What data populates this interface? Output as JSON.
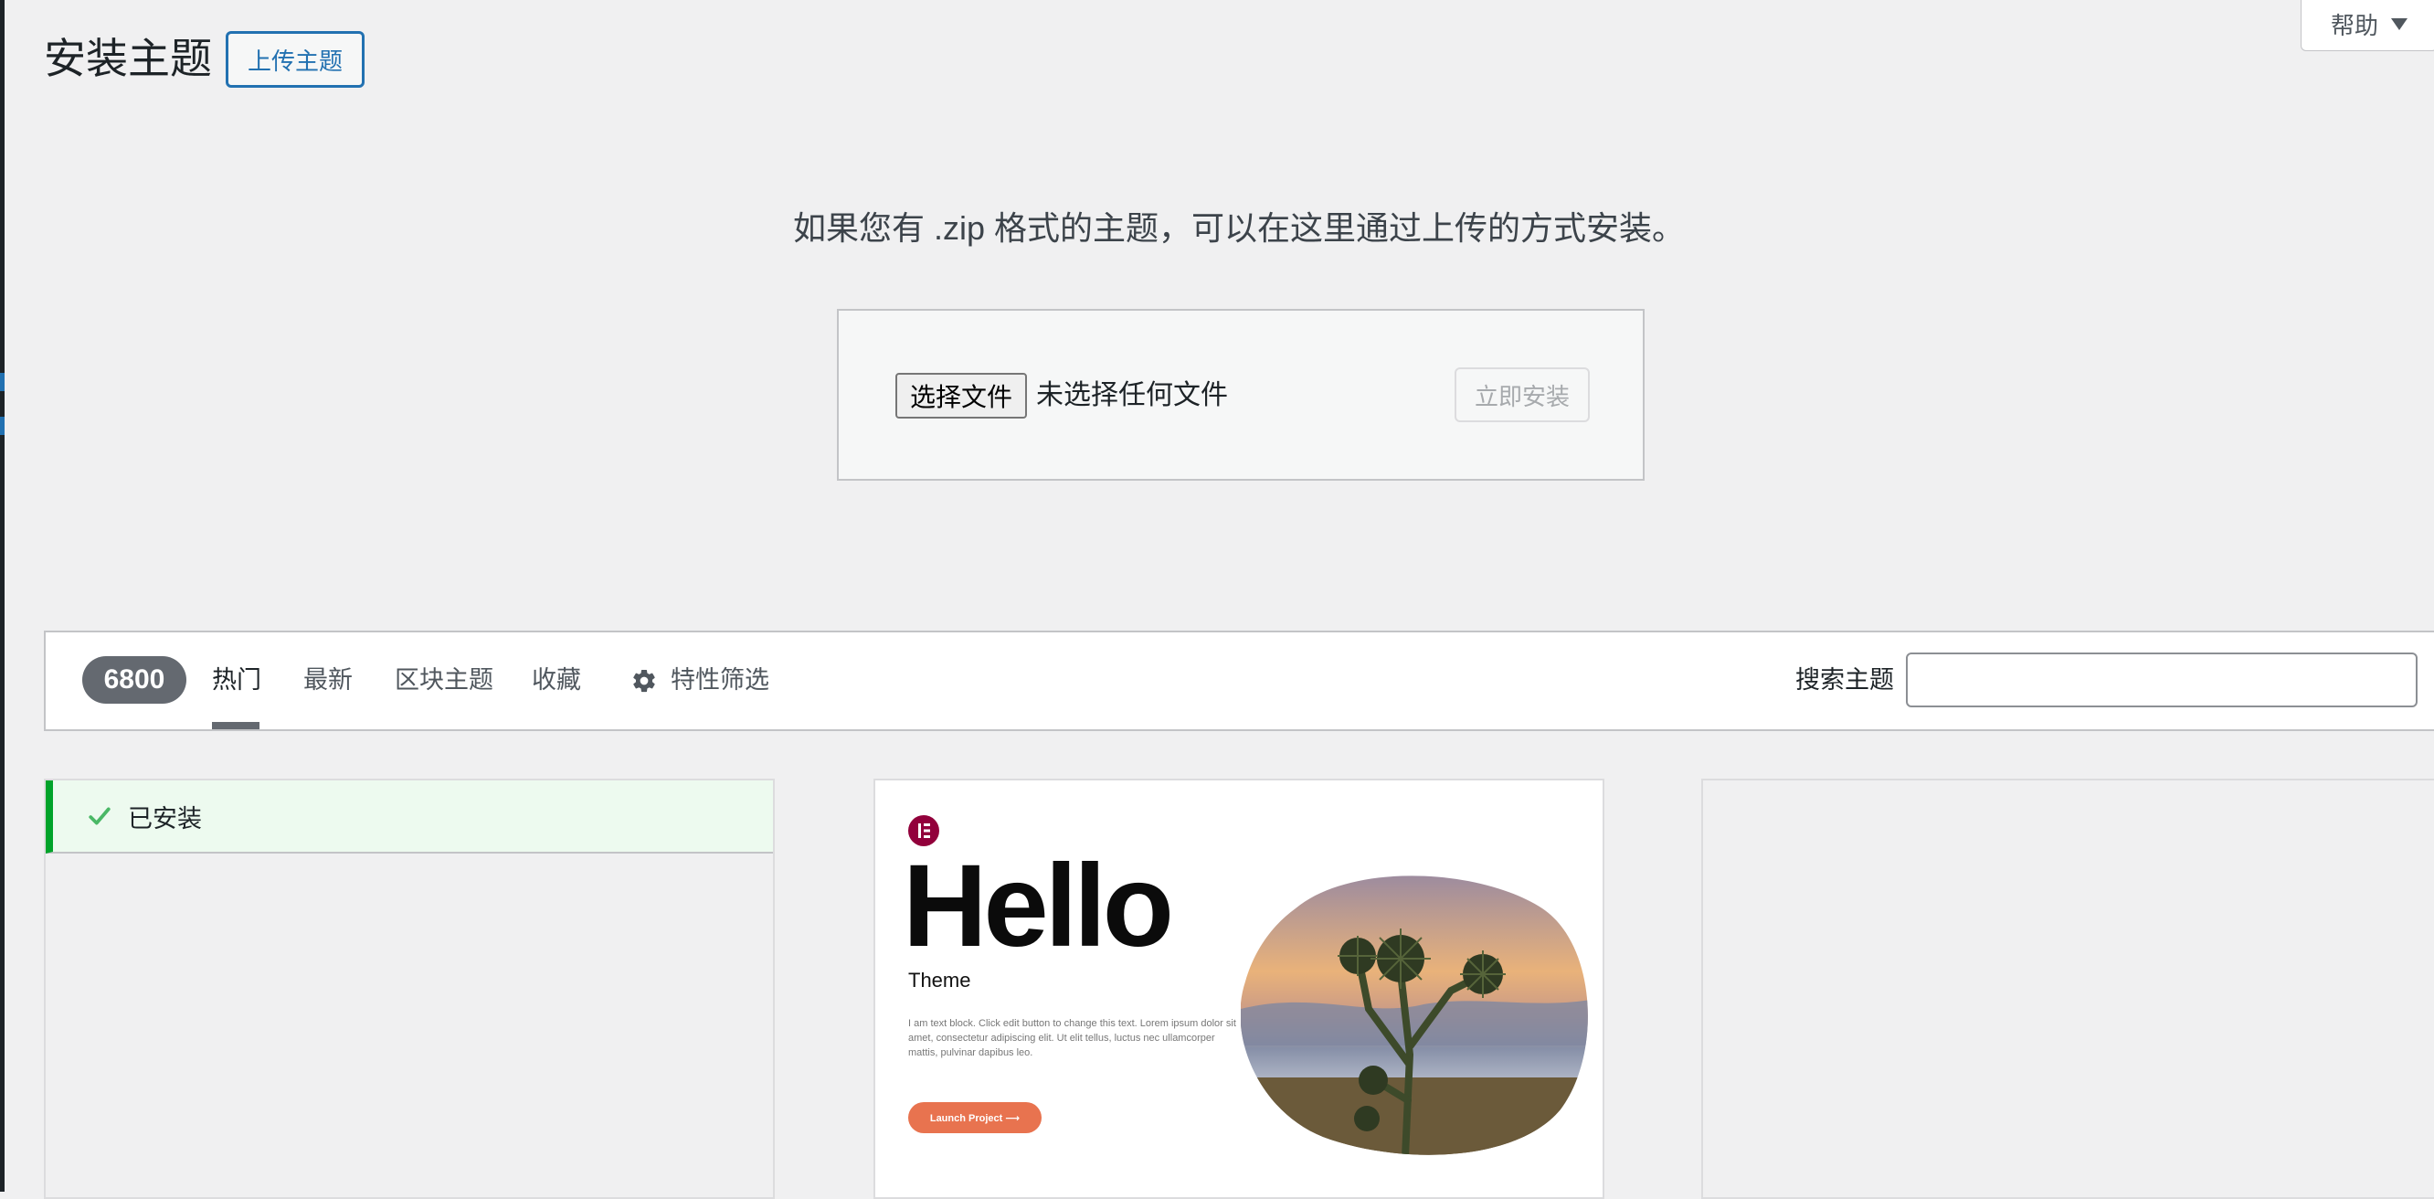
{
  "page": {
    "title": "安装主题",
    "upload_theme_button": "上传主题",
    "help_label": "帮助"
  },
  "upload": {
    "intro": "如果您有 .zip 格式的主题，可以在这里通过上传的方式安装。",
    "choose_file_button": "选择文件",
    "file_status": "未选择任何文件",
    "install_button": "立即安装"
  },
  "filter": {
    "count": "6800",
    "tabs": [
      "热门",
      "最新",
      "区块主题",
      "收藏"
    ],
    "active_tab": "热门",
    "feature_filter_label": "特性筛选",
    "search_label": "搜索主题",
    "search_value": ""
  },
  "themes": {
    "installed_label": "已安装",
    "hello": {
      "title": "Hello",
      "subtitle": "Theme",
      "body": "I am text block. Click edit button to change this text. Lorem ipsum dolor sit amet, consectetur adipiscing elit. Ut elit tellus, luctus nec ullamcorper mattis, pulvinar dapibus leo.",
      "button": "Launch Project  ⟶"
    }
  },
  "colors": {
    "accent": "#2271b1",
    "installed_green": "#00a32a",
    "hello_button": "#e8734f",
    "elementor_logo": "#92003b"
  }
}
